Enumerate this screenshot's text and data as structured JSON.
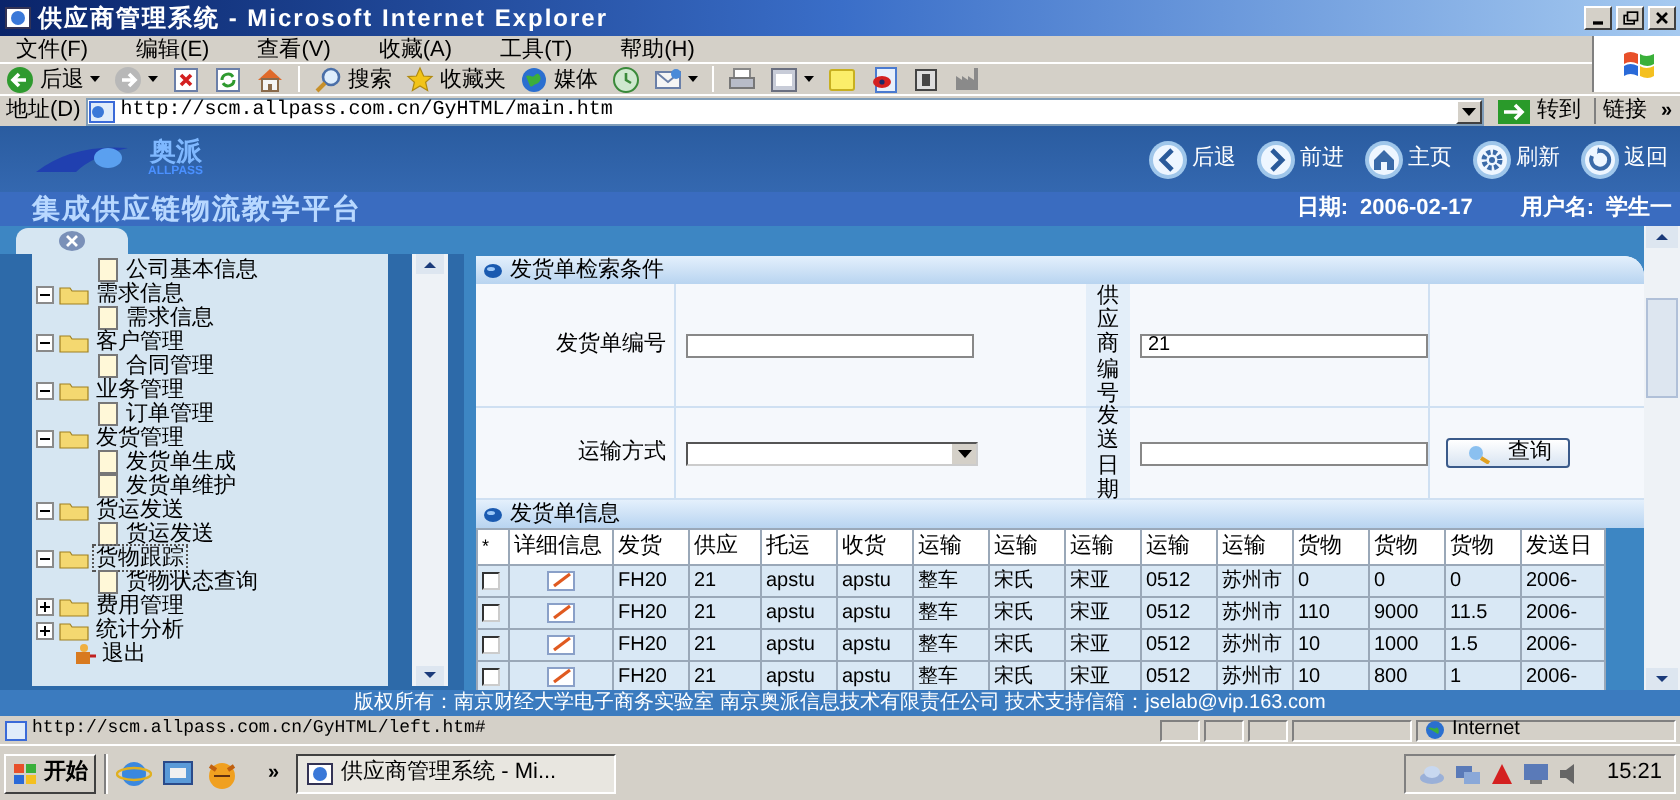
{
  "window": {
    "title": "供应商管理系统 - Microsoft Internet Explorer"
  },
  "menu": [
    "文件(F)",
    "编辑(E)",
    "查看(V)",
    "收藏(A)",
    "工具(T)",
    "帮助(H)"
  ],
  "toolbar": [
    {
      "kind": "back",
      "label": "后退",
      "dropdown": true
    },
    {
      "kind": "forward",
      "dropdown": true
    },
    {
      "kind": "stop"
    },
    {
      "kind": "refresh"
    },
    {
      "kind": "home"
    },
    {
      "kind": "search",
      "label": "搜索"
    },
    {
      "kind": "favorites",
      "label": "收藏夹"
    },
    {
      "kind": "media",
      "label": "媒体"
    },
    {
      "kind": "history"
    },
    {
      "kind": "mail",
      "dropdown": true
    },
    {
      "kind": "print"
    },
    {
      "kind": "edit",
      "dropdown": true
    },
    {
      "kind": "note"
    },
    {
      "kind": "messenger"
    },
    {
      "kind": "research"
    },
    {
      "kind": "tool"
    }
  ],
  "address": {
    "label": "地址(D)",
    "url": "http://scm.allpass.com.cn/GyHTML/main.htm",
    "go": "转到",
    "links": "链接",
    "more": "»"
  },
  "banner": {
    "logo_name": "奥派",
    "logo_sub": "ALLPASS",
    "platform": "集成供应链物流教学平台",
    "nav": [
      {
        "kind": "back",
        "label": "后退"
      },
      {
        "kind": "forward",
        "label": "前进"
      },
      {
        "kind": "home",
        "label": "主页"
      },
      {
        "kind": "refresh",
        "label": "刷新"
      },
      {
        "kind": "return",
        "label": "返回"
      }
    ],
    "date_label": "日期:",
    "date": "2006-02-17",
    "user_label": "用户名:",
    "user": "学生一"
  },
  "sidebar": {
    "tree": [
      {
        "expanded": true,
        "children": [
          {
            "label": "公司基本信息"
          }
        ]
      },
      {
        "label": "需求信息",
        "expanded": true,
        "selected": false,
        "children": [
          {
            "label": "需求信息"
          }
        ]
      },
      {
        "label": "客户管理",
        "expanded": true,
        "selected": false,
        "children": [
          {
            "label": "合同管理"
          }
        ]
      },
      {
        "label": "业务管理",
        "expanded": true,
        "selected": false,
        "children": [
          {
            "label": "订单管理"
          }
        ]
      },
      {
        "label": "发货管理",
        "expanded": true,
        "selected": false,
        "children": [
          {
            "label": "发货单生成"
          },
          {
            "label": "发货单维护"
          }
        ]
      },
      {
        "label": "货运发送",
        "expanded": true,
        "selected": false,
        "children": [
          {
            "label": "货运发送"
          }
        ]
      },
      {
        "label": "货物跟踪",
        "expanded": true,
        "selected": true,
        "children": [
          {
            "label": "货物状态查询"
          }
        ]
      },
      {
        "label": "费用管理",
        "expanded": false,
        "selected": false
      },
      {
        "label": "统计分析",
        "expanded": false,
        "selected": false
      },
      {
        "label": "退出",
        "kind": "exit"
      }
    ]
  },
  "search": {
    "title": "发货单检索条件",
    "fields": [
      {
        "label": "发货单编号",
        "kind": "text"
      },
      {
        "label": "供应商编号",
        "kind": "text",
        "value": "21"
      },
      {
        "label": "运输方式",
        "kind": "select"
      },
      {
        "label": "发送日期",
        "kind": "text"
      }
    ],
    "button": "查询"
  },
  "results": {
    "title": "发货单信息",
    "columns": [
      "*",
      "详细信息",
      "发货",
      "供应",
      "托运",
      "收货",
      "运输",
      "运输",
      "运输",
      "运输",
      "运输",
      "货物",
      "货物",
      "货物",
      "发送日"
    ],
    "rows": [
      {
        "checked": false,
        "cells": [
          "",
          "",
          "FH20",
          "21",
          "apstu",
          "apstu",
          "整车",
          "宋氏",
          "宋亚",
          "0512",
          "苏州市",
          "0",
          "0",
          "0",
          "2006-"
        ]
      },
      {
        "checked": false,
        "cells": [
          "",
          "",
          "FH20",
          "21",
          "apstu",
          "apstu",
          "整车",
          "宋氏",
          "宋亚",
          "0512",
          "苏州市",
          "110",
          "9000",
          "11.5",
          "2006-"
        ]
      },
      {
        "checked": false,
        "cells": [
          "",
          "",
          "FH20",
          "21",
          "apstu",
          "apstu",
          "整车",
          "宋氏",
          "宋亚",
          "0512",
          "苏州市",
          "10",
          "1000",
          "1.5",
          "2006-"
        ]
      },
      {
        "checked": false,
        "cells": [
          "",
          "",
          "FH20",
          "21",
          "apstu",
          "apstu",
          "整车",
          "宋氏",
          "宋亚",
          "0512",
          "苏州市",
          "10",
          "800",
          "1",
          "2006-"
        ]
      }
    ]
  },
  "footer": "版权所有：南京财经大学电子商务实验室 南京奥派信息技术有限责任公司 技术支持信箱：jselab@vip.163.com",
  "status_bar": {
    "url": "http://scm.allpass.com.cn/GyHTML/left.htm#",
    "zone": "Internet"
  },
  "taskbar": {
    "start": "开始",
    "more": "»",
    "task": "供应商管理系统 - Mi...",
    "clock": "15:21"
  }
}
